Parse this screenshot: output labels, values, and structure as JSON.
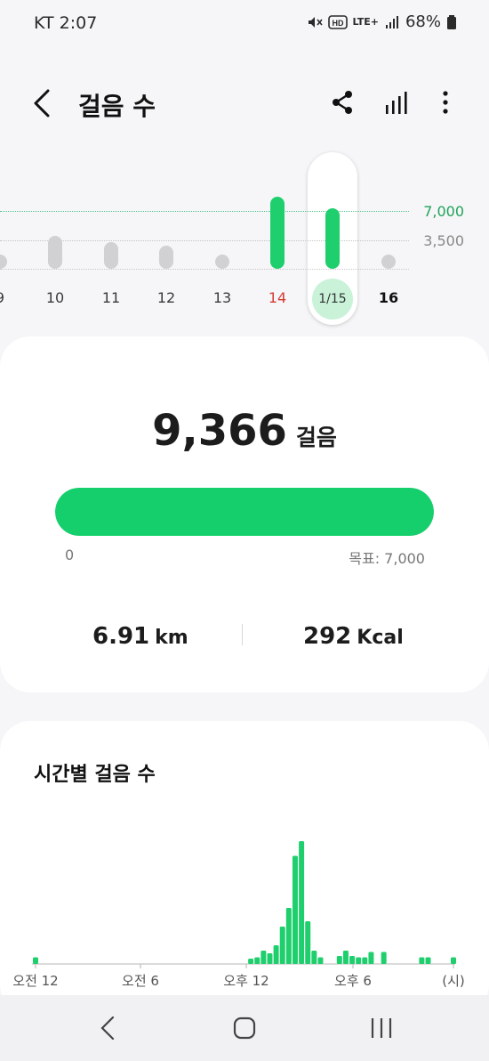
{
  "status": {
    "carrier": "KT 2:07",
    "network": "LTE+",
    "battery": "68%"
  },
  "header": {
    "title": "걸음 수"
  },
  "week": {
    "ref_high": "7,000",
    "ref_low": "3,500",
    "days": [
      {
        "label": "9",
        "steps": 300,
        "met": false
      },
      {
        "label": "10",
        "steps": 3100,
        "met": false
      },
      {
        "label": "11",
        "steps": 2400,
        "met": false
      },
      {
        "label": "12",
        "steps": 1900,
        "met": false
      },
      {
        "label": "13",
        "steps": 200,
        "met": false
      },
      {
        "label": "14",
        "steps": 7900,
        "met": true,
        "sunday": true
      },
      {
        "label": "1/15",
        "steps": 6500,
        "met": true,
        "selected": true
      },
      {
        "label": "16",
        "steps": 150,
        "met": false,
        "today": true
      }
    ]
  },
  "summary": {
    "steps": "9,366",
    "steps_unit": "걸음",
    "progress_fraction": 1.0,
    "range_min": "0",
    "goal_label": "목표: 7,000",
    "distance": "6.91",
    "distance_unit": "km",
    "calories": "292",
    "calories_unit": "Kcal"
  },
  "hourly": {
    "title": "시간별 걸음 수",
    "axis_labels": [
      "오전 12",
      "오전 6",
      "오후 12",
      "오후 6",
      "(시)"
    ],
    "values": [
      0.05,
      0,
      0,
      0,
      0,
      0,
      0,
      0,
      0,
      0,
      0,
      0,
      0,
      0,
      0,
      0,
      0,
      0,
      0,
      0,
      0,
      0,
      0,
      0,
      0,
      0,
      0,
      0,
      0,
      0,
      0,
      0,
      0,
      0,
      0.04,
      0.05,
      0.1,
      0.08,
      0.14,
      0.28,
      0.42,
      0.81,
      0.92,
      0.32,
      0.1,
      0.05,
      0,
      0,
      0.06,
      0.1,
      0.06,
      0.05,
      0.05,
      0.09,
      0,
      0.09,
      0,
      0,
      0,
      0,
      0,
      0.05,
      0.05,
      0,
      0,
      0,
      0.05
    ],
    "color": "#1fcf6d"
  },
  "colors": {
    "accent": "#14cf6b",
    "goal_line": "#1fa35a",
    "sunday": "#d63b34"
  },
  "icons": [
    "back-arrow-icon",
    "share-icon",
    "bar-chart-icon",
    "more-vert-icon",
    "mute-icon",
    "hd-icon",
    "signal-icon",
    "battery-icon",
    "nav-back-icon",
    "nav-home-icon",
    "nav-recents-icon"
  ]
}
